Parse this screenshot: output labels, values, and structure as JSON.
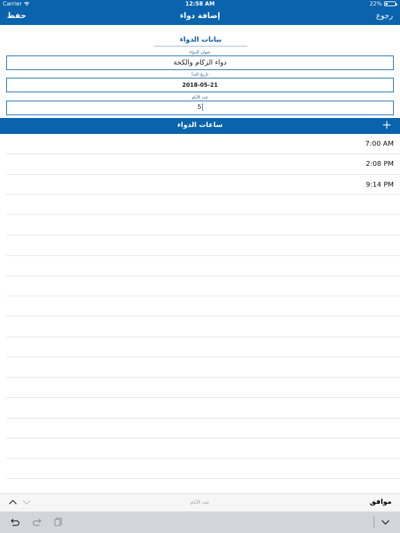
{
  "status_bar": {
    "carrier": "Carrier",
    "time": "12:58 AM",
    "battery": "22%"
  },
  "nav": {
    "save_label": "حفظ",
    "title": "إضافة دواء",
    "back_label": "رجوع"
  },
  "form": {
    "section_title": "بيانات الدواء",
    "name_label": "عنوان الدواء",
    "name_value": "دواء الزكام والكحة",
    "date_label": "تاريخ البدأ",
    "date_value": "2018-05-21",
    "days_label": "عدد الأيام",
    "days_value": "5"
  },
  "hours": {
    "header": "ساعات الدواء",
    "add_icon": "plus-icon",
    "times": [
      "7:00 AM",
      "2:08 PM",
      "9:14 PM",
      "",
      "",
      "",
      "",
      "",
      "",
      "",
      "",
      "",
      "",
      "",
      "",
      "",
      "",
      ""
    ]
  },
  "accessory": {
    "placeholder": "عدد الأيام",
    "done_label": "موافق"
  },
  "colors": {
    "brand_blue": "#0a63ad"
  }
}
